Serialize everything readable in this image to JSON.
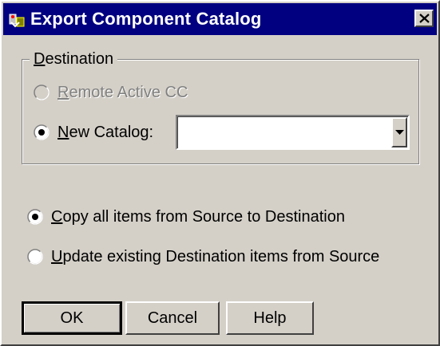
{
  "window": {
    "title": "Export Component Catalog"
  },
  "destination": {
    "legend": "Destination",
    "remote_label": "Remote Active CC",
    "remote_selected": false,
    "remote_enabled": false,
    "new_catalog_label": "New Catalog:",
    "new_catalog_selected": true,
    "new_catalog_value": ""
  },
  "copy_mode": {
    "copy_all_label": "Copy all items from Source to Destination",
    "copy_all_selected": true,
    "update_existing_label": "Update existing Destination items from Source",
    "update_existing_selected": false
  },
  "buttons": {
    "ok_label": "OK",
    "cancel_label": "Cancel",
    "help_label": "Help"
  },
  "icons": {
    "app": "catalog-export-icon",
    "close": "close-icon",
    "dropdown": "chevron-down-icon"
  },
  "colors": {
    "titlebar": "#000080",
    "dialog_bg": "#d4d0c8",
    "disabled_text": "#808080"
  }
}
